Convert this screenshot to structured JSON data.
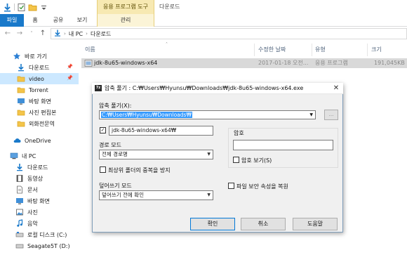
{
  "window": {
    "context_tab_group": "응용 프로그램 도구",
    "title": "다운로드"
  },
  "ribbon": {
    "tabs": [
      "파일",
      "홈",
      "공유",
      "보기"
    ],
    "context_tab": "관리"
  },
  "address": {
    "crumbs": [
      "내 PC",
      "다운로드"
    ]
  },
  "sidebar": {
    "items": [
      {
        "label": "바로 가기",
        "icon": "star-icon",
        "pinned": false
      },
      {
        "label": "다운로드",
        "icon": "download-icon",
        "pinned": true
      },
      {
        "label": "video",
        "icon": "folder-icon",
        "pinned": true,
        "selected": true
      },
      {
        "label": "Torrent",
        "icon": "folder-icon",
        "pinned": false
      },
      {
        "label": "바탕 화면",
        "icon": "desktop-icon",
        "pinned": false
      },
      {
        "label": "사진 편집본",
        "icon": "folder-icon",
        "pinned": false
      },
      {
        "label": "외화전문역",
        "icon": "folder-icon",
        "pinned": false
      },
      {
        "label": "OneDrive",
        "icon": "cloud-icon",
        "pinned": false
      },
      {
        "label": "내 PC",
        "icon": "computer-icon",
        "pinned": false
      },
      {
        "label": "다운로드",
        "icon": "download-icon",
        "pinned": false
      },
      {
        "label": "동영상",
        "icon": "video-icon",
        "pinned": false
      },
      {
        "label": "문서",
        "icon": "document-icon",
        "pinned": false
      },
      {
        "label": "바탕 화면",
        "icon": "desktop-icon",
        "pinned": false
      },
      {
        "label": "사진",
        "icon": "picture-icon",
        "pinned": false
      },
      {
        "label": "음악",
        "icon": "music-icon",
        "pinned": false
      },
      {
        "label": "로컬 디스크 (C:)",
        "icon": "drive-icon",
        "pinned": false
      },
      {
        "label": "Seagate5T (D:)",
        "icon": "drive-icon",
        "pinned": false
      }
    ]
  },
  "file_list": {
    "columns": [
      "이름",
      "수정한 날짜",
      "유형",
      "크기"
    ],
    "rows": [
      {
        "name": "jdk-8u65-windows-x64",
        "modified": "2017-01-18 오전...",
        "type": "응용 프로그램",
        "size": "191,045KB"
      }
    ]
  },
  "dialog": {
    "app_icon_text": "7z",
    "title": "압축 풀기 : C:₩Users₩Hyunsu₩Downloads₩jdk-8u65-windows-x64.exe",
    "extract_to_label": "압축 풀기(X):",
    "extract_to_value": "C:₩Users₩Hyunsu₩Downloads₩",
    "browse_label": "...",
    "subfolder_value": "jdk-8u65-windows-x64₩",
    "subfolder_checked": true,
    "path_mode_label": "경로 모드",
    "path_mode_value": "전체 경로명",
    "eliminate_dup_label": "최상위 폴더의 중복을 방지",
    "eliminate_dup_checked": false,
    "overwrite_mode_label": "덮어쓰기 모드",
    "overwrite_mode_value": "덮어쓰기 전에 확인",
    "password_label": "암호",
    "show_password_label": "암호 보기(S)",
    "show_password_checked": false,
    "restore_security_label": "파일 보안 속성을 복원",
    "restore_security_checked": false,
    "ok_label": "확인",
    "cancel_label": "취소",
    "help_label": "도움말",
    "check_mark": "✓"
  },
  "colors": {
    "file_tab": "#1979ca",
    "selection": "#cce8ff",
    "context_tab": "#f7e9b2",
    "highlight": "#3399ff"
  }
}
